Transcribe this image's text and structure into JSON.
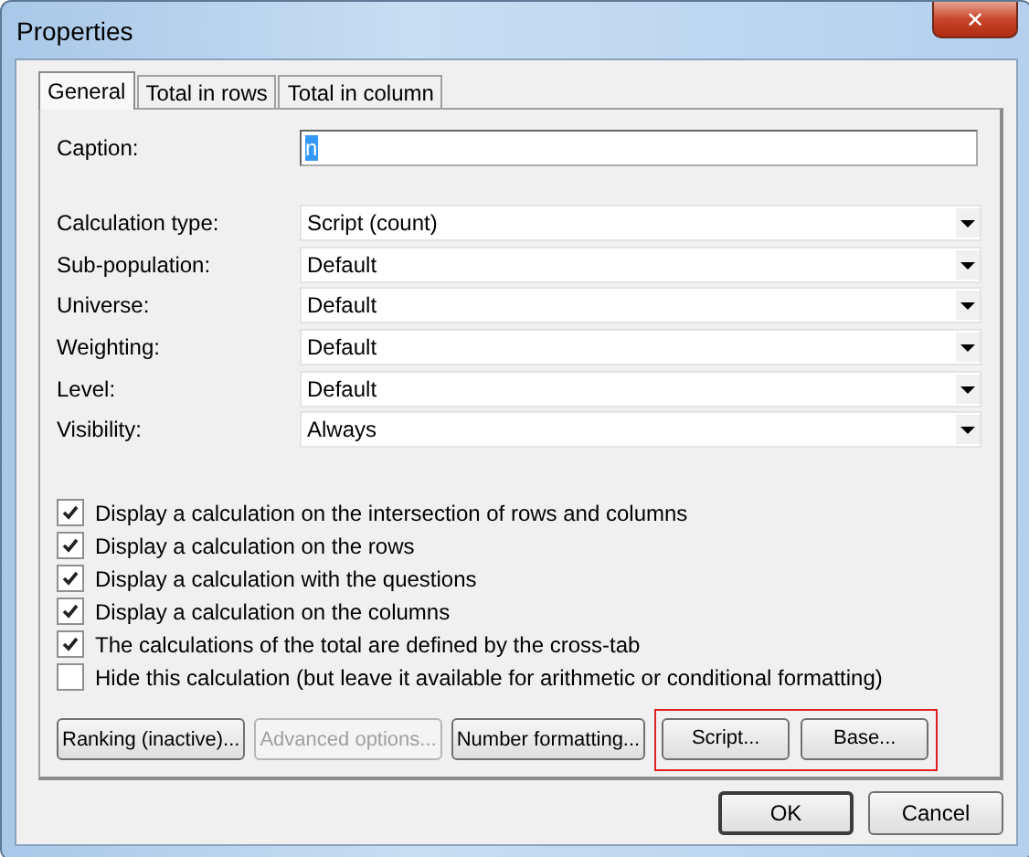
{
  "window": {
    "title": "Properties",
    "close": "✕"
  },
  "tabs": [
    {
      "label": "General",
      "selected": true
    },
    {
      "label": "Total in rows",
      "selected": false
    },
    {
      "label": "Total in column",
      "selected": false
    }
  ],
  "caption": {
    "label": "Caption:",
    "value": "n",
    "value_selected": true
  },
  "dropdowns": [
    {
      "label": "Calculation type:",
      "value": "Script (count)"
    },
    {
      "label": "Sub-population:",
      "value": "Default"
    },
    {
      "label": "Universe:",
      "value": "Default"
    },
    {
      "label": "Weighting:",
      "value": "Default"
    },
    {
      "label": "Level:",
      "value": "Default"
    },
    {
      "label": "Visibility:",
      "value": "Always"
    }
  ],
  "checkboxes": [
    {
      "label": "Display a calculation on the intersection of rows and columns",
      "checked": true
    },
    {
      "label": "Display a calculation on the rows",
      "checked": true
    },
    {
      "label": "Display a calculation with the questions",
      "checked": true
    },
    {
      "label": "Display a calculation on the columns",
      "checked": true
    },
    {
      "label": "The calculations of the total are defined by the cross-tab",
      "checked": true
    },
    {
      "label": "Hide this calculation (but leave it available for arithmetic or conditional formatting)",
      "checked": false
    }
  ],
  "buttons": [
    {
      "label": "Ranking (inactive)...",
      "disabled": false
    },
    {
      "label": "Advanced options...",
      "disabled": true
    },
    {
      "label": "Number formatting...",
      "disabled": false
    }
  ],
  "highlighted_buttons": [
    {
      "label": "Script..."
    },
    {
      "label": "Base..."
    }
  ],
  "dialog_buttons": [
    {
      "label": "OK",
      "default": true
    },
    {
      "label": "Cancel",
      "default": false
    }
  ]
}
